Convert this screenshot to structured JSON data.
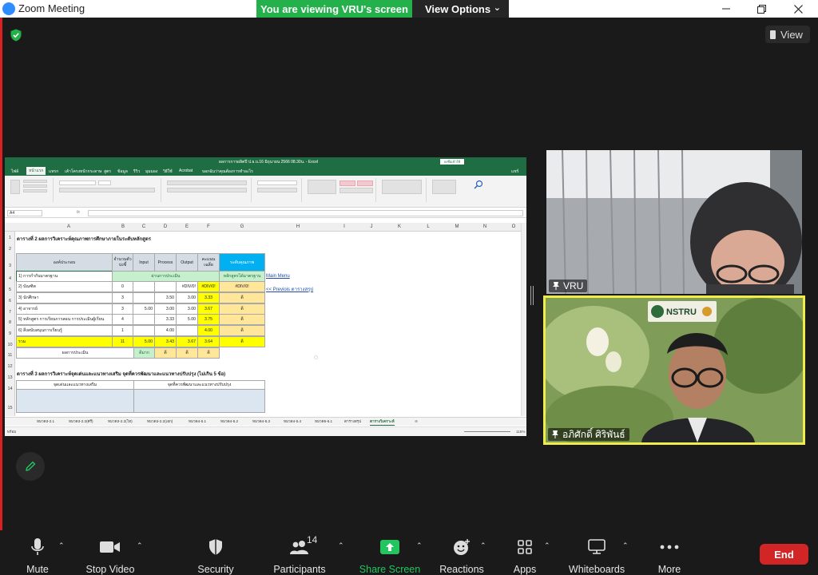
{
  "window": {
    "title": "Zoom Meeting",
    "banner": "You are viewing VRU's screen",
    "view_options": "View Options",
    "view_button": "View"
  },
  "excel": {
    "doc_title": "ผลการการผลิตปี ป.ธ.บ.16 มิถุนายน 2566 08.30น. - Excel",
    "sign_in": "ลงชื่อเข้าใช้",
    "ribbon_tabs": [
      "ไฟล์",
      "หน้าแรก",
      "แทรก",
      "เค้าโครงหน้ากระดาษ",
      "สูตร",
      "ข้อมูล",
      "รีวิว",
      "มุมมอง",
      "วิธีใช้",
      "Acrobat",
      "บอกฉันว่าคุณต้องการทำอะไร",
      "แชร์"
    ],
    "name_box": "A4",
    "fx": "fx",
    "columns": [
      "A",
      "B",
      "C",
      "D",
      "E",
      "F",
      "G",
      "H",
      "I",
      "J",
      "K",
      "L",
      "M",
      "N",
      "O",
      "P",
      "Q"
    ],
    "rows": [
      "1",
      "2",
      "3",
      "4",
      "5",
      "6",
      "7",
      "8",
      "9",
      "10",
      "11",
      "12",
      "13",
      "14",
      "15"
    ],
    "table2_title": "ตารางที่ 2 ผลการวิเคราะห์คุณภาพการศึกษาภายในระดับหลักสูตร",
    "headers": {
      "component": "องค์ประกอบ",
      "count": "จำนวนตัวบ่งชี้",
      "input": "Input",
      "process": "Process",
      "output": "Output",
      "average": "คะแนนเฉลี่ย",
      "level": "ระดับคุณภาพ"
    },
    "row4": {
      "label": "1) การกำกับมาตรฐาน",
      "merged": "ผ่านการประเมิน",
      "standard": "หลักสูตรได้มาตรฐาน"
    },
    "data_rows": [
      {
        "label": "2) บัณฑิต",
        "count": "0",
        "input": "",
        "process": "",
        "output": "#DIV/0!",
        "average": "#DIV/0!",
        "level": "#DIV/0!"
      },
      {
        "label": "3) นักศึกษา",
        "count": "3",
        "input": "",
        "process": "3.50",
        "output": "3.00",
        "average": "3.33",
        "level": "ดี"
      },
      {
        "label": "4) อาจารย์",
        "count": "3",
        "input": "5.00",
        "process": "3.00",
        "output": "3.00",
        "average": "3.67",
        "level": "ดี"
      },
      {
        "label": "5) หลักสูตร การเรียนการสอน การประเมินผู้เรียน",
        "count": "4",
        "input": "",
        "process": "3.33",
        "output": "5.00",
        "average": "3.75",
        "level": "ดี"
      },
      {
        "label": "6) สิ่งสนับสนุนการเรียนรู้",
        "count": "1",
        "input": "",
        "process": "4.00",
        "output": "",
        "average": "4.00",
        "level": "ดี"
      }
    ],
    "total_row": {
      "label": "รวม",
      "count": "11",
      "input": "5.00",
      "process": "3.43",
      "output": "3.67",
      "average": "3.64",
      "level": "ดี"
    },
    "result_row": {
      "label": "ผลการประเมิน",
      "input": "ดีมาก",
      "process": "ดี",
      "output": "ดี",
      "average": "ดี"
    },
    "links": {
      "main_menu": "Main Menu",
      "previous": "<< Previois ตารางสรุป"
    },
    "table3_title": "ตารางที่ 3 ผลการวิเคราะห์จุดเด่นและแนวทางเสริม จุดที่ควรพัฒนาและแนวทางปรับปรุง (ไม่เกิน 5 ข้อ)",
    "table3_headers": [
      "จุดเด่นและแนวทางเสริม",
      "จุดที่ควรพัฒนาและแนวทางปรับปรุง"
    ],
    "sheet_tabs": [
      "หมวด3-2.1",
      "หมวด3-2.2(ศรี)",
      "หมวด3-2.2(โท)",
      "หมวด3-2.2(เอก)",
      "หมวด4-5.1",
      "หมวด4-5.2",
      "หมวด4-5.3",
      "หมวด4-5.4",
      "หมวด5-6.1",
      "ตารางสรุป",
      "ตารางวิเคราะห์"
    ],
    "status_ready": "พร้อม",
    "zoom": "115%"
  },
  "participants": {
    "vru_name": "VRU",
    "host_name": "อภิศักดิ์ ศิริพันธ์",
    "logo_text": "NSTRU"
  },
  "toolbar": {
    "mute": "Mute",
    "stop_video": "Stop Video",
    "security": "Security",
    "participants": "Participants",
    "participants_count": "14",
    "share_screen": "Share Screen",
    "reactions": "Reactions",
    "apps": "Apps",
    "whiteboards": "Whiteboards",
    "more": "More",
    "end": "End"
  },
  "colors": {
    "share_green": "#24b14c",
    "end_red": "#d22525",
    "speaker_border": "#f0ec4a",
    "excel_green": "#1f6e43"
  }
}
